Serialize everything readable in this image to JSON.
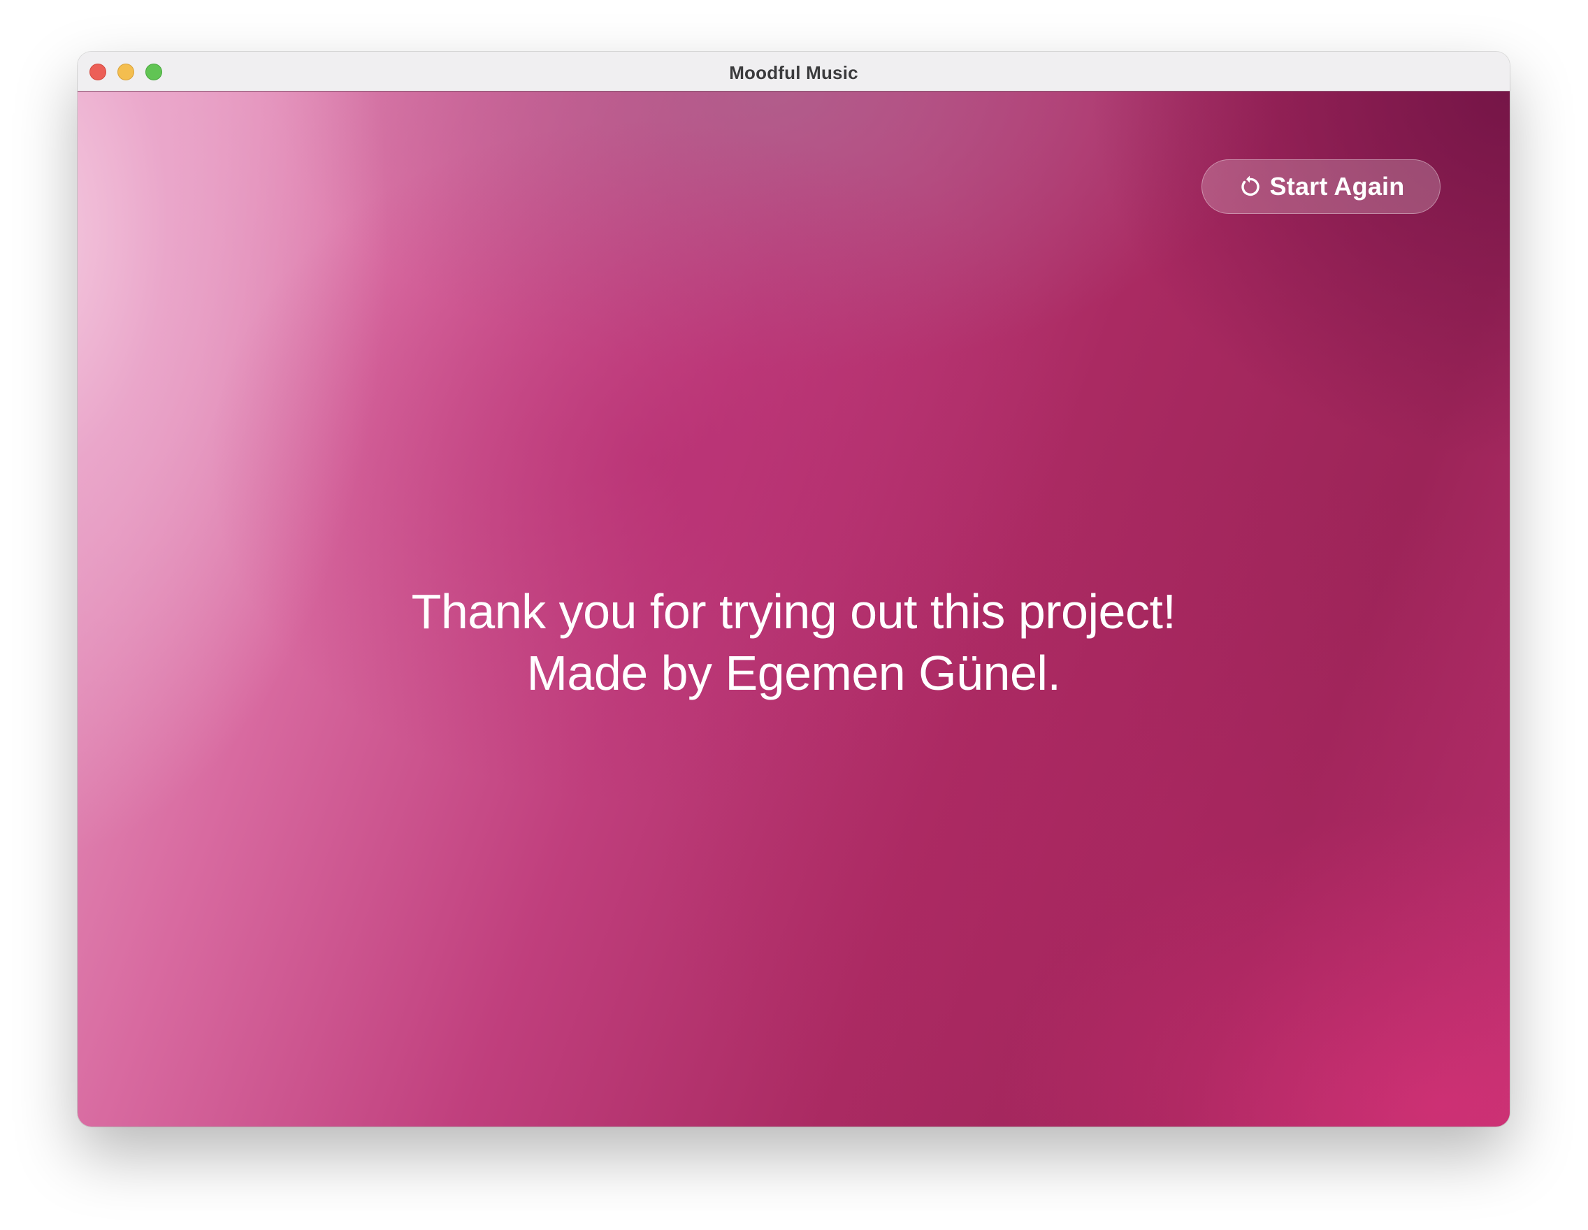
{
  "window": {
    "title": "Moodful Music"
  },
  "toolbar": {
    "start_again_label": "Start Again",
    "start_again_icon": "restart-icon"
  },
  "main": {
    "message_line1": "Thank you for trying out this project!",
    "message_line2": "Made by Egemen Günel."
  },
  "colors": {
    "accent": "#a8285f",
    "close": "#ec5f57",
    "minimize": "#f4be4f",
    "zoom": "#61c454"
  }
}
